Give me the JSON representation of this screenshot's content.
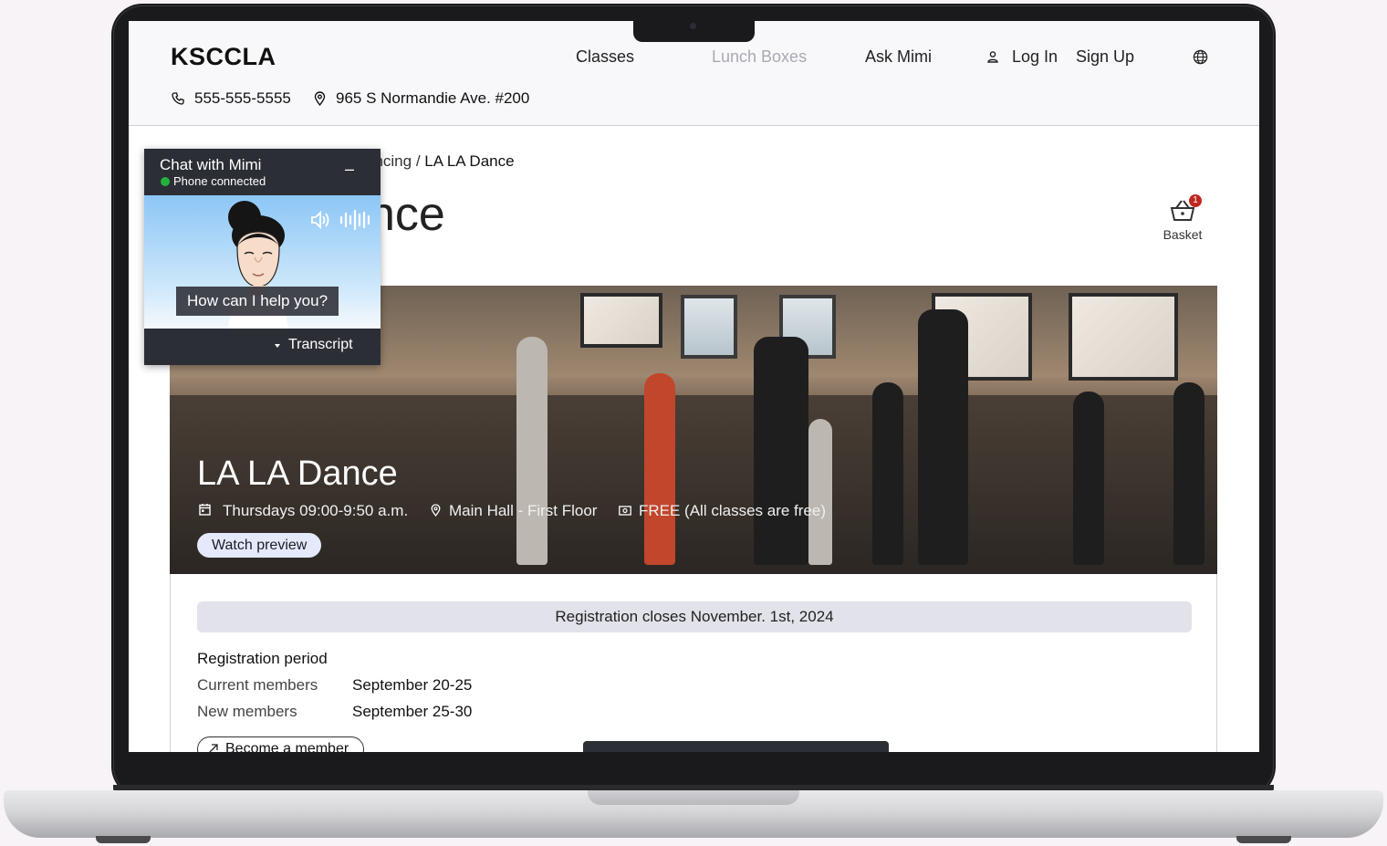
{
  "header": {
    "logo": "KSCCLA",
    "nav": {
      "classes": "Classes",
      "lunch_boxes": "Lunch Boxes",
      "ask_mimi": "Ask Mimi",
      "log_in": "Log In",
      "sign_up": "Sign Up"
    },
    "phone": "555-555-5555",
    "address": "965 S Normandie Ave. #200"
  },
  "breadcrumb": {
    "visible_prefix": "ancing / ",
    "current": "LA LA Dance"
  },
  "page_title_visible": "nce",
  "basket": {
    "label": "Basket",
    "count": "1"
  },
  "hero": {
    "title": "LA LA Dance",
    "schedule": "Thursdays 09:00-9:50 a.m.",
    "location": "Main Hall - First Floor",
    "fee": "FREE (All classes are free)",
    "preview_button": "Watch preview"
  },
  "registration": {
    "banner": "Registration closes November. 1st, 2024",
    "heading": "Registration period",
    "rows": [
      {
        "label": "Current members",
        "value": "September 20-25"
      },
      {
        "label": "New members",
        "value": "September 25-30"
      }
    ],
    "member_button": "Become a member"
  },
  "chat": {
    "title": "Chat with Mimi",
    "status": "Phone connected",
    "minimize": "–",
    "prompt": "How can I help you?",
    "transcript": "Transcript"
  }
}
